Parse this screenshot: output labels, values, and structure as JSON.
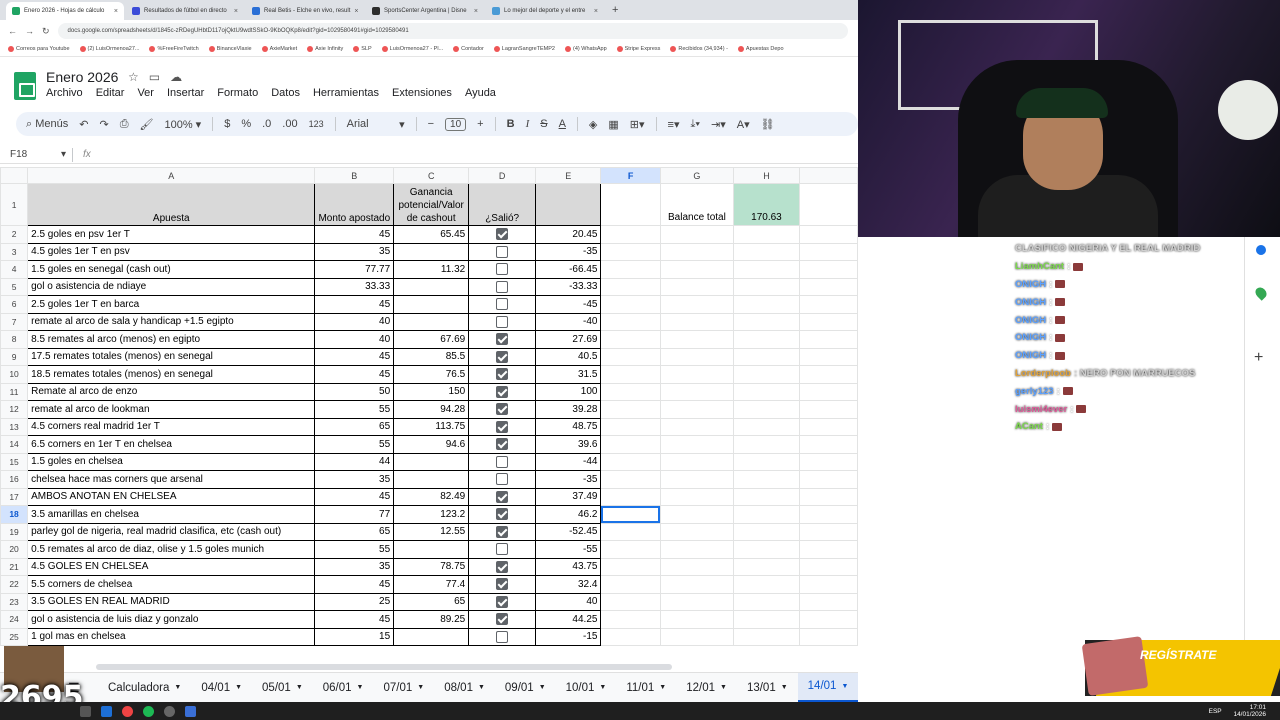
{
  "browser": {
    "tabs": [
      {
        "title": "Enero 2026 - Hojas de cálculo",
        "active": true,
        "color": "#1fa463"
      },
      {
        "title": "Resultados de fútbol en directo",
        "active": false,
        "color": "#3b4bd8"
      },
      {
        "title": "Real Betis - Elche en vivo, result",
        "active": false,
        "color": "#2a6fd6"
      },
      {
        "title": "SportsCenter Argentina | Disne",
        "active": false,
        "color": "#2d2d2d"
      },
      {
        "title": "Lo mejor del deporte y el entre",
        "active": false,
        "color": "#4a9bd6"
      }
    ],
    "url": "docs.google.com/spreadsheets/d/1845c-zRDegUHbtD117ojQktU9wdtSSkO-9KbOQKp8/edit?gid=1029580491#gid=1029580491",
    "bookmarks": [
      "Correos para Youtube",
      "(2) LuisOrmenoa27...",
      "%FreeFireTwitch",
      "BinanceVlaxie",
      "AxieMarket",
      "Axie Infinity",
      "SLP",
      "LuisOrmenoa27 - Pl...",
      "Contador",
      "LagranSangreTEMP2",
      "(4) WhatsApp",
      "Stripe Express",
      "Recibidos (34,934) -",
      "Apuestas Depo"
    ]
  },
  "sheets": {
    "doc_title": "Enero 2026",
    "menu": [
      "Archivo",
      "Editar",
      "Ver",
      "Insertar",
      "Formato",
      "Datos",
      "Herramientas",
      "Extensiones",
      "Ayuda"
    ],
    "toolbar": {
      "menus": "Menús",
      "zoom": "100%",
      "currency": "$",
      "percent": "%",
      "dec_minus": ".0",
      "dec_plus": ".00",
      "format_123": "123",
      "font": "Arial",
      "font_size": "10"
    },
    "name_box": "F18",
    "fx": "fx",
    "columns": [
      "A",
      "B",
      "C",
      "D",
      "E",
      "F",
      "G",
      "H",
      "",
      "",
      "",
      "",
      "",
      "",
      "",
      ""
    ],
    "header_row": {
      "apuesta": "Apuesta",
      "monto": "Monto apostado",
      "ganancia": "Ganancia potencial/Valor de cashout",
      "salio": "¿Salió?",
      "balance_label": "Balance total",
      "balance_value": "170.63"
    },
    "rows": [
      {
        "n": "2",
        "a": "2.5 goles en psv 1er T",
        "b": "45",
        "c": "65.45",
        "d": true,
        "e": "20.45"
      },
      {
        "n": "3",
        "a": "4.5 goles 1er T en psv",
        "b": "35",
        "c": "",
        "d": false,
        "e": "-35"
      },
      {
        "n": "4",
        "a": "1.5 goles en senegal (cash out)",
        "b": "77.77",
        "c": "11.32",
        "d": false,
        "e": "-66.45"
      },
      {
        "n": "5",
        "a": "gol o asistencia de ndiaye",
        "b": "33.33",
        "c": "",
        "d": false,
        "e": "-33.33"
      },
      {
        "n": "6",
        "a": "2.5 goles 1er T en barca",
        "b": "45",
        "c": "",
        "d": false,
        "e": "-45"
      },
      {
        "n": "7",
        "a": "remate al arco de sala y handicap +1.5 egipto",
        "b": "40",
        "c": "",
        "d": false,
        "e": "-40"
      },
      {
        "n": "8",
        "a": "8.5 remates al arco (menos) en egipto",
        "b": "40",
        "c": "67.69",
        "d": true,
        "e": "27.69"
      },
      {
        "n": "9",
        "a": "17.5 remates totales (menos) en senegal",
        "b": "45",
        "c": "85.5",
        "d": true,
        "e": "40.5"
      },
      {
        "n": "10",
        "a": "18.5 remates totales (menos) en senegal",
        "b": "45",
        "c": "76.5",
        "d": true,
        "e": "31.5"
      },
      {
        "n": "11",
        "a": "Remate al arco de enzo",
        "b": "50",
        "c": "150",
        "d": true,
        "e": "100"
      },
      {
        "n": "12",
        "a": "remate al arco de lookman",
        "b": "55",
        "c": "94.28",
        "d": true,
        "e": "39.28"
      },
      {
        "n": "13",
        "a": "4.5 corners real madrid 1er T",
        "b": "65",
        "c": "113.75",
        "d": true,
        "e": "48.75"
      },
      {
        "n": "14",
        "a": "6.5 corners en 1er T en chelsea",
        "b": "55",
        "c": "94.6",
        "d": true,
        "e": "39.6"
      },
      {
        "n": "15",
        "a": "1.5 goles en chelsea",
        "b": "44",
        "c": "",
        "d": false,
        "e": "-44"
      },
      {
        "n": "16",
        "a": "chelsea hace mas corners que arsenal",
        "b": "35",
        "c": "",
        "d": false,
        "e": "-35"
      },
      {
        "n": "17",
        "a": "AMBOS ANOTAN EN CHELSEA",
        "b": "45",
        "c": "82.49",
        "d": true,
        "e": "37.49"
      },
      {
        "n": "18",
        "a": "3.5 amarillas en chelsea",
        "b": "77",
        "c": "123.2",
        "d": true,
        "e": "46.2"
      },
      {
        "n": "19",
        "a": "parley gol de nigeria, real madrid clasifica, etc (cash out)",
        "b": "65",
        "c": "12.55",
        "d": true,
        "e": "-52.45"
      },
      {
        "n": "20",
        "a": "0.5 remates al arco de diaz, olise y 1.5 goles munich",
        "b": "55",
        "c": "",
        "d": false,
        "e": "-55"
      },
      {
        "n": "21",
        "a": "4.5 GOLES EN CHELSEA",
        "b": "35",
        "c": "78.75",
        "d": true,
        "e": "43.75"
      },
      {
        "n": "22",
        "a": "5.5 corners de chelsea",
        "b": "45",
        "c": "77.4",
        "d": true,
        "e": "32.4"
      },
      {
        "n": "23",
        "a": "3.5 GOLES EN REAL MADRID",
        "b": "25",
        "c": "65",
        "d": true,
        "e": "40"
      },
      {
        "n": "24",
        "a": "gol o asistencia de luis diaz y gonzalo",
        "b": "45",
        "c": "89.25",
        "d": true,
        "e": "44.25"
      },
      {
        "n": "25",
        "a": "1 gol mas en chelsea",
        "b": "15",
        "c": "",
        "d": false,
        "e": "-15"
      }
    ],
    "sheet_tabs": [
      "Calculadora",
      "04/01",
      "05/01",
      "06/01",
      "07/01",
      "08/01",
      "09/01",
      "10/01",
      "11/01",
      "12/01",
      "13/01",
      "14/01"
    ],
    "active_sheet": "14/01"
  },
  "stream": {
    "chat": [
      {
        "user": "CLASIFICO NIGERIA Y EL REAL MADRID",
        "text": "",
        "color": "#d0d0d0"
      },
      {
        "user": "LiamhCant",
        "text": ":",
        "color": "#7bd94c"
      },
      {
        "user": "ONIGH",
        "text": ":",
        "color": "#5aa0ff"
      },
      {
        "user": "ONIGH",
        "text": ":",
        "color": "#5aa0ff"
      },
      {
        "user": "ONIGH",
        "text": ":",
        "color": "#5aa0ff"
      },
      {
        "user": "ONIGH",
        "text": ":",
        "color": "#5aa0ff"
      },
      {
        "user": "ONIGH",
        "text": ":",
        "color": "#5aa0ff"
      },
      {
        "user": "Lorderploob",
        "text": ": NERO PON MARRUECOS",
        "color": "#e0a23a"
      },
      {
        "user": "gerly123",
        "text": ":",
        "color": "#5aa0ff"
      },
      {
        "user": "luismi4ever",
        "text": ":",
        "color": "#e05a9a"
      },
      {
        "user": "ACant",
        "text": ":",
        "color": "#7bd94c"
      }
    ],
    "promo": "REGÍSTRATE",
    "counter": "2695",
    "clock_time": "17:01",
    "clock_date": "14/01/2026",
    "lang": "ESP"
  }
}
